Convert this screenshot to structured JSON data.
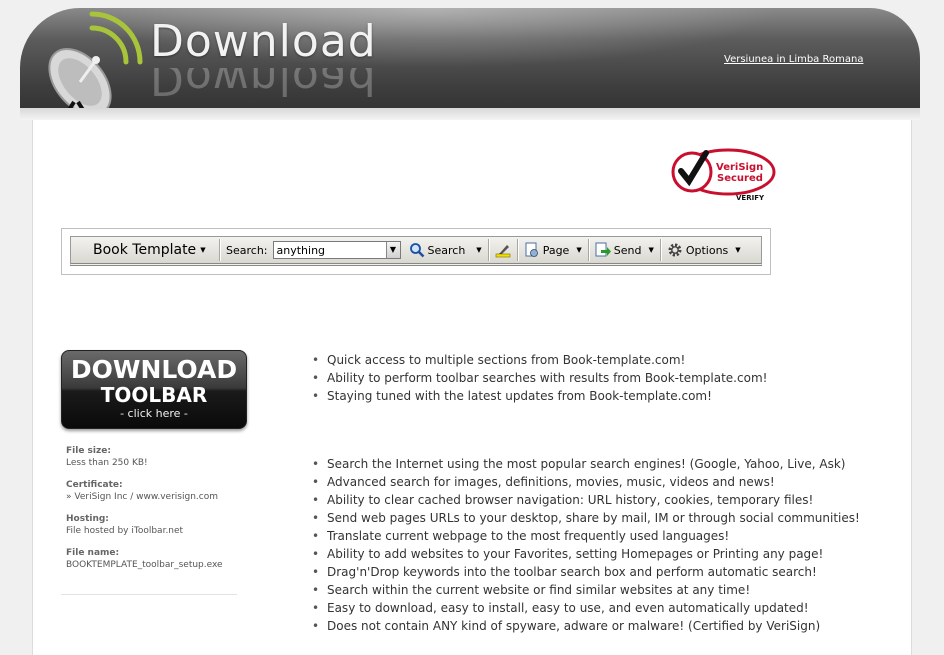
{
  "header": {
    "logo_text": "Download",
    "lang_link": "Versiunea in Limba Romana"
  },
  "verisign": {
    "line1": "VeriSign",
    "line2": "Secured",
    "verify": "VERIFY"
  },
  "toolbar_preview": {
    "brand": "Book Template",
    "search_label": "Search:",
    "search_value": "anything",
    "search_button": "Search",
    "page_button": "Page",
    "send_button": "Send",
    "options_button": "Options"
  },
  "download_button": {
    "line1": "DOWNLOAD",
    "line2": "TOOLBAR",
    "line3": "- click here -"
  },
  "file_info": [
    {
      "label": "File size:",
      "value": "Less than 250 KB!"
    },
    {
      "label": "Certificate:",
      "value": "» VeriSign Inc / www.verisign.com"
    },
    {
      "label": "Hosting:",
      "value": "File hosted by iToolbar.net"
    },
    {
      "label": "File name:",
      "value": "BOOKTEMPLATE_toolbar_setup.exe"
    }
  ],
  "features_main": [
    "Quick access to multiple sections from Book-template.com!",
    "Ability to perform toolbar searches with results from Book-template.com!",
    "Staying tuned with the latest updates from Book-template.com!"
  ],
  "features_general": [
    "Search the Internet using the most popular search engines! (Google, Yahoo, Live, Ask)",
    "Advanced search for images, definitions, movies, music, videos and news!",
    "Ability to clear cached browser navigation: URL history, cookies, temporary files!",
    "Send web pages URLs to your desktop, share by mail, IM or through social communities!",
    "Translate current webpage to the most frequently used languages!",
    "Ability to add websites to your Favorites, setting Homepages or Printing any page!",
    "Drag'n'Drop keywords into the toolbar search box and perform automatic search!",
    "Search within the current website or find similar websites at any time!",
    "Easy to download, easy to install, easy to use, and even automatically updated!",
    "Does not contain ANY kind of spyware, adware or malware! (Certified by VeriSign)"
  ],
  "colors": {
    "header_dark": "#3e3e3e",
    "logo_green": "#a8c43a",
    "verisign_red": "#c8102e"
  }
}
